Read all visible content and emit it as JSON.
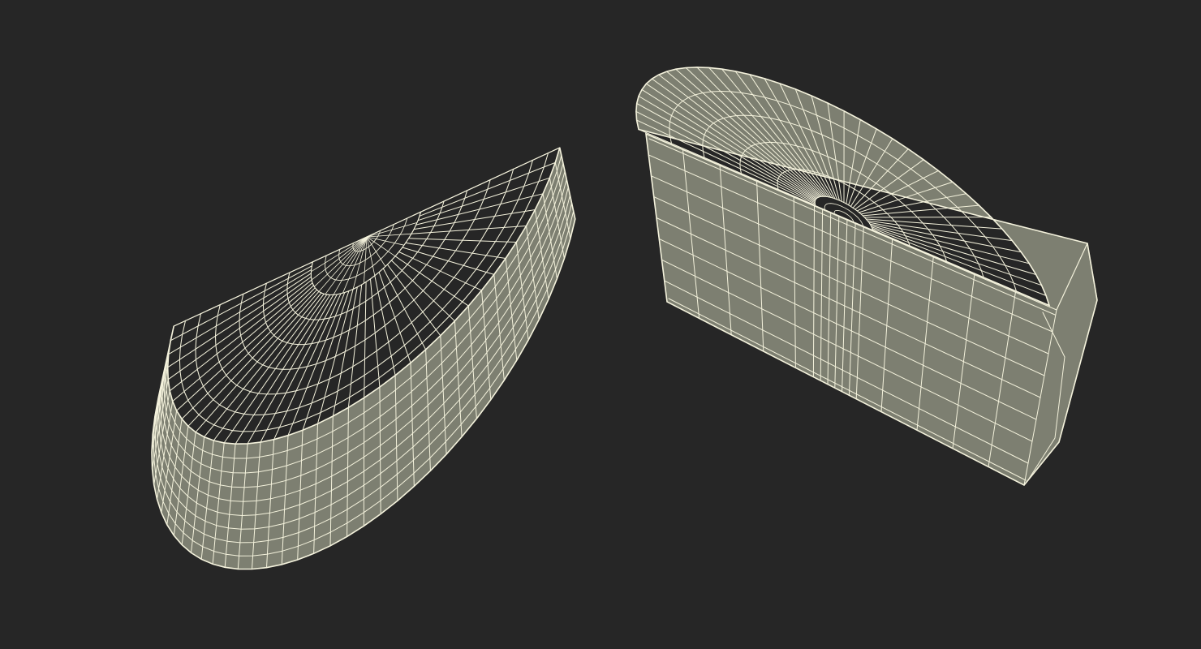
{
  "scene": {
    "background_color": "#262626",
    "surface_color": "#7d7f71",
    "wire_color": "#f4f2dc",
    "objects": [
      {
        "name": "half-cheese-wheel-left",
        "view": "top-and-rind"
      },
      {
        "name": "half-cheese-wheel-right",
        "view": "cut-face-and-top"
      }
    ]
  }
}
